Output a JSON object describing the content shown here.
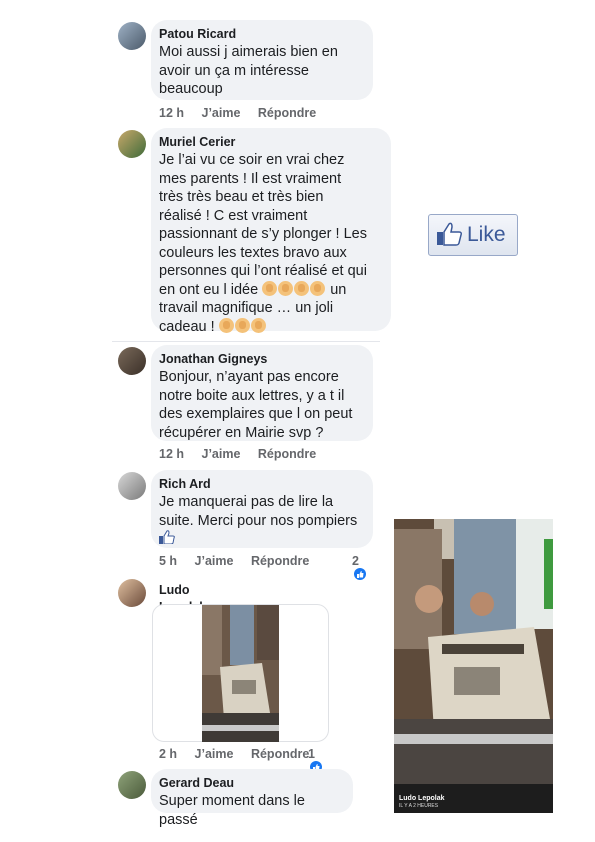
{
  "comments": [
    {
      "name": "Patou Ricard",
      "text": "Moi aussi j aimerais bien en\navoir un ça m intéresse\nbeaucoup",
      "time": "12 h",
      "like": "J’aime",
      "reply": "Répondre"
    },
    {
      "name": "Muriel Cerier",
      "text": "Je l’ai vu ce soir en vrai chez\nmes parents ! Il est vraiment\ntrès très beau et très bien\nréalisé ! C est vraiment\npassionnant de s’y plonger ! Les\ncouleurs les textes bravo aux\npersonnes qui l’ont réalisé et qui\nen ont eu l idée",
      "text2": " un\ntravail magnifique … un joli\ncadeau ! "
    },
    {
      "name": "Jonathan Gigneys",
      "text": "Bonjour, n’ayant pas encore\nnotre boite aux lettres, y a t il\ndes exemplaires que l on peut\nrécupérer en Mairie svp ?",
      "time": "12 h",
      "like": "J’aime",
      "reply": "Répondre"
    },
    {
      "name": "Rich Ard",
      "text": "Je manquerai pas de lire la\nsuite. Merci pour nos pompiers",
      "time": "5 h",
      "like": "J’aime",
      "reply": "Répondre",
      "reactions": "2"
    },
    {
      "name": "Ludo Lepolak",
      "time": "2 h",
      "like": "J’aime",
      "reply": "Répondre",
      "reactions": "1"
    },
    {
      "name": "Gerard Deau",
      "text": "Super moment dans le passé"
    }
  ],
  "like_button": {
    "label": "Like"
  },
  "photo": {
    "author": "Ludo Lepolak",
    "time": "IL Y A 2 HEURES"
  },
  "colors": {
    "bubble": "#f0f2f5",
    "meta": "#65676b",
    "facebook_blue": "#3b5998",
    "reaction_blue": "#1877f2"
  }
}
